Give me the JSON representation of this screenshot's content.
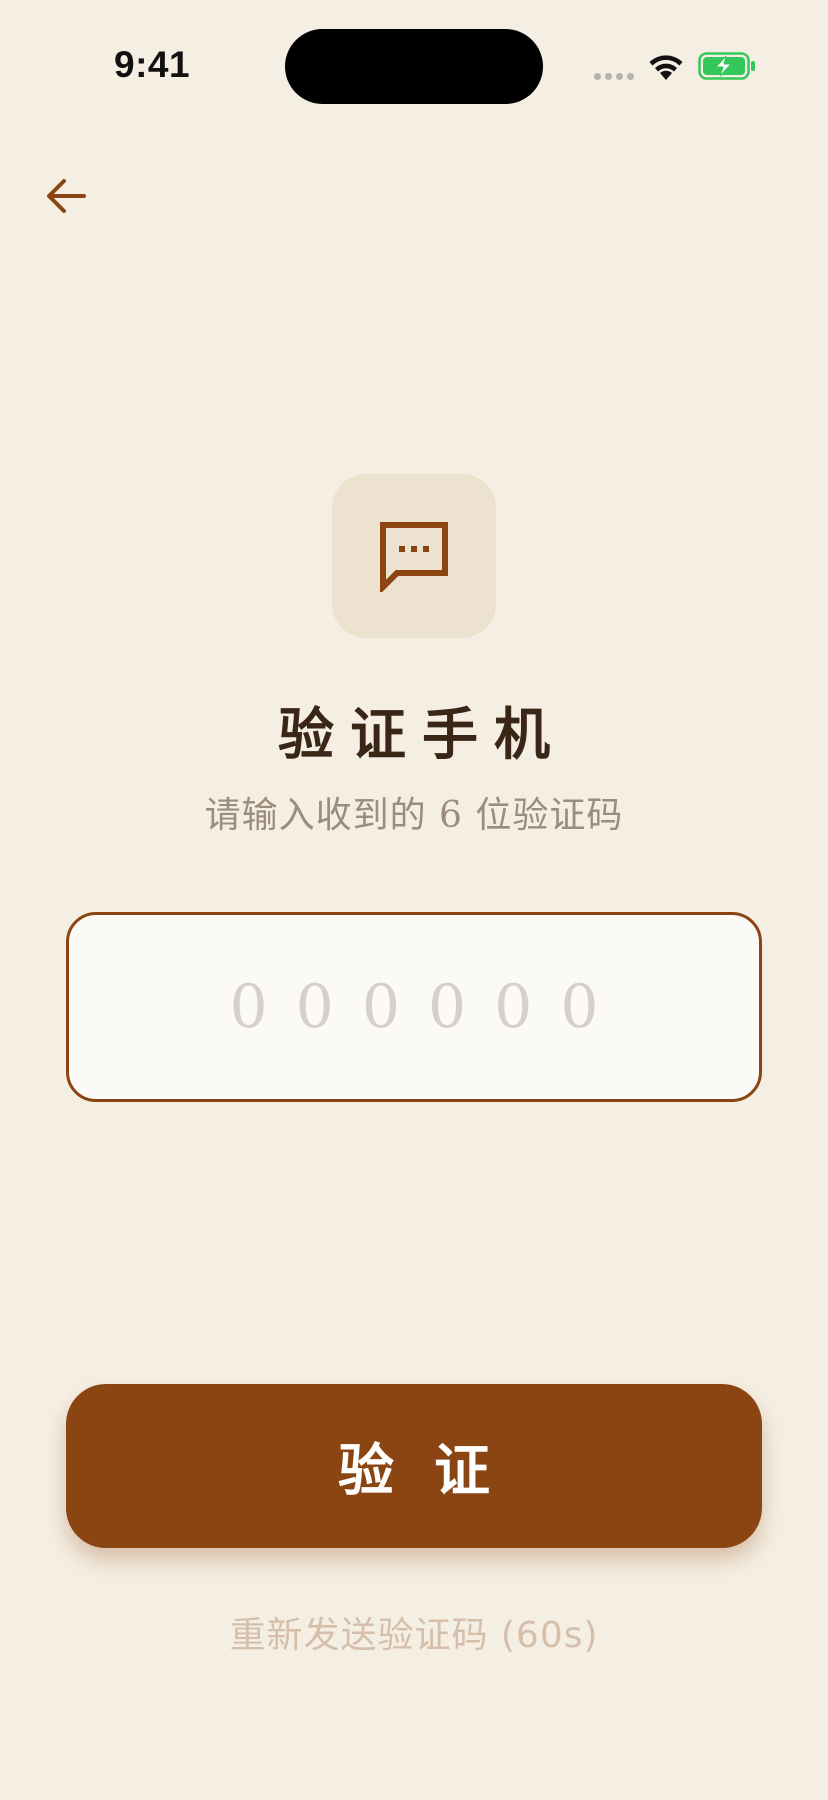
{
  "status_bar": {
    "time": "9:41"
  },
  "nav": {
    "back_icon": "arrow-left-icon"
  },
  "header": {
    "icon": "message-dots-icon",
    "title": "验证手机",
    "subtitle": "请输入收到的 6 位验证码"
  },
  "code_input": {
    "value": "",
    "placeholder": "000000"
  },
  "actions": {
    "verify_label": "验证",
    "resend_label": "重新发送验证码 (60s)"
  },
  "colors": {
    "background": "#F5EFE3",
    "accent": "#8B4513",
    "icon_tile": "#EDE1CF",
    "title": "#3A2616",
    "subtitle": "#9C8C7C",
    "resend": "#D6BFAA",
    "battery": "#34C759"
  }
}
